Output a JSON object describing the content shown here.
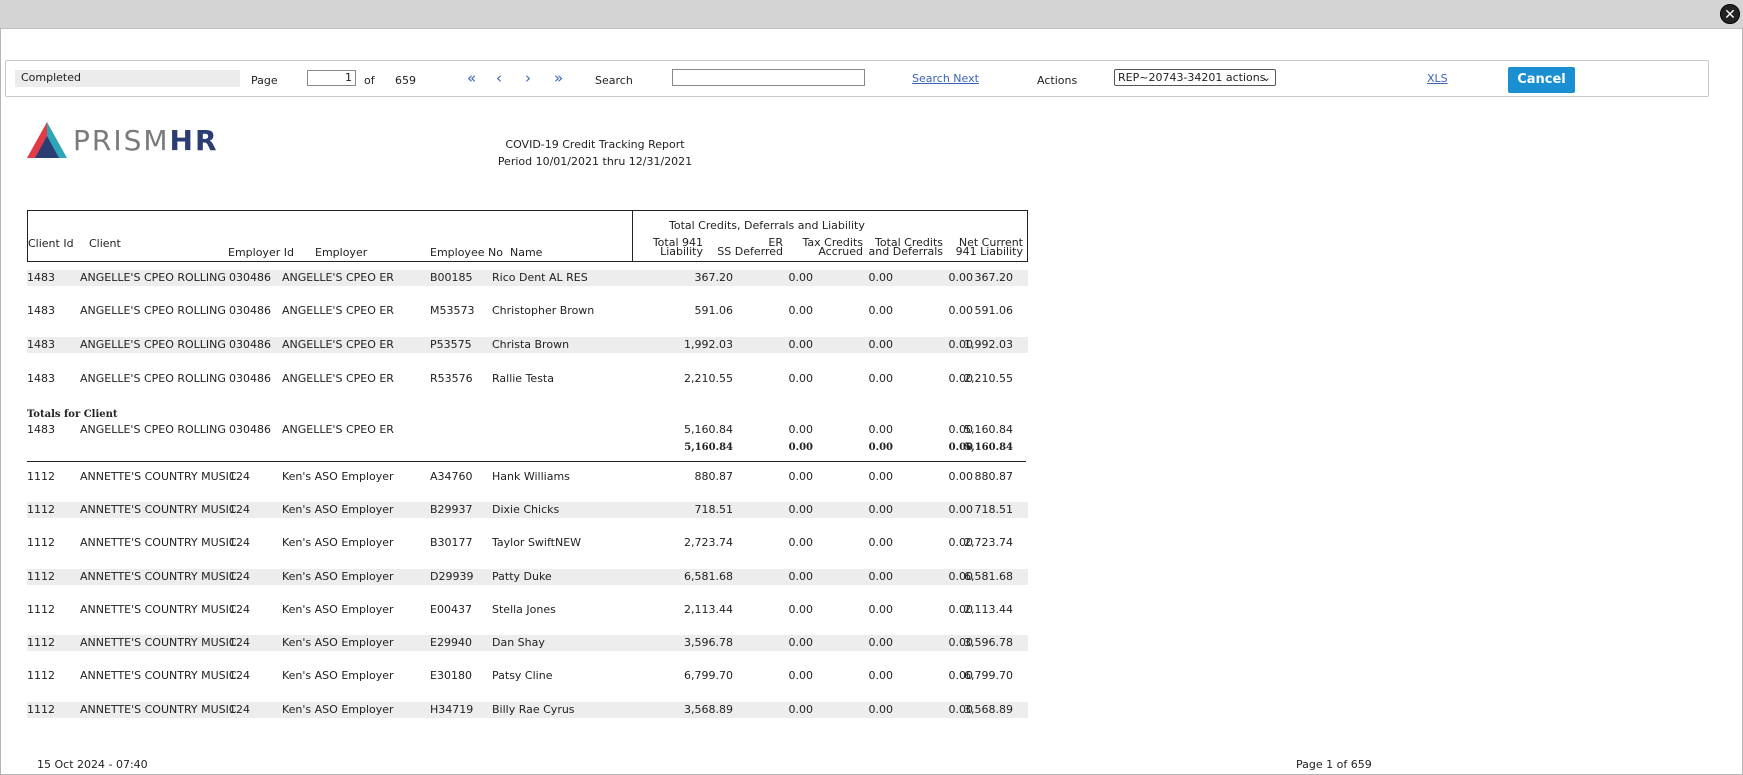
{
  "toolbar": {
    "status": "Completed",
    "page_label": "Page",
    "page_value": "1",
    "of_label": "of",
    "total_pages": "659",
    "search_label": "Search",
    "search_value": "",
    "search_next": "Search Next",
    "actions_label": "Actions",
    "actions_selected": "REP~20743-34201 actions",
    "xls": "XLS",
    "cancel": "Cancel"
  },
  "logo": {
    "part1": "PRISM",
    "part2": "HR"
  },
  "report": {
    "title": "COVID-19 Credit Tracking Report",
    "period": "Period 10/01/2021 thru 12/31/2021"
  },
  "headers": {
    "group": "Total Credits, Deferrals and Liability",
    "client_id": "Client Id",
    "client": "Client",
    "employer_id": "Employer Id",
    "employer": "Employer",
    "employee_no": "Employee No",
    "name": "Name",
    "total941_1": "Total 941",
    "total941_2": "Liability",
    "er_1": "ER",
    "er_2": "SS Deferred",
    "tax_1": "Tax Credits",
    "tax_2": "Accrued",
    "tcd_1": "Total Credits",
    "tcd_2": "and Deferrals",
    "net_1": "Net Current",
    "net_2": "941 Liability"
  },
  "rows_group1": [
    {
      "client_id": "1483",
      "client": "ANGELLE'S CPEO ROLLING",
      "employer_id": "030486",
      "employer": "ANGELLE'S CPEO ER",
      "employee_no": "B00185",
      "name": "Rico Dent AL RES",
      "total": "367.20",
      "er": "0.00",
      "tax": "0.00",
      "tcd": "0.00",
      "net": "367.20"
    },
    {
      "client_id": "1483",
      "client": "ANGELLE'S CPEO ROLLING",
      "employer_id": "030486",
      "employer": "ANGELLE'S CPEO ER",
      "employee_no": "M53573",
      "name": "Christopher Brown",
      "total": "591.06",
      "er": "0.00",
      "tax": "0.00",
      "tcd": "0.00",
      "net": "591.06"
    },
    {
      "client_id": "1483",
      "client": "ANGELLE'S CPEO ROLLING",
      "employer_id": "030486",
      "employer": "ANGELLE'S CPEO ER",
      "employee_no": "P53575",
      "name": "Christa Brown",
      "total": "1,992.03",
      "er": "0.00",
      "tax": "0.00",
      "tcd": "0.00",
      "net": "1,992.03"
    },
    {
      "client_id": "1483",
      "client": "ANGELLE'S CPEO ROLLING",
      "employer_id": "030486",
      "employer": "ANGELLE'S CPEO ER",
      "employee_no": "R53576",
      "name": "Rallie Testa",
      "total": "2,210.55",
      "er": "0.00",
      "tax": "0.00",
      "tcd": "0.00",
      "net": "2,210.55"
    }
  ],
  "totals": {
    "label": "Totals for Client",
    "row": {
      "client_id": "1483",
      "client": "ANGELLE'S CPEO ROLLING",
      "employer_id": "030486",
      "employer": "ANGELLE'S CPEO ER",
      "total": "5,160.84",
      "er": "0.00",
      "tax": "0.00",
      "tcd": "0.00",
      "net": "5,160.84"
    },
    "sub": {
      "total": "5,160.84",
      "er": "0.00",
      "tax": "0.00",
      "tcd": "0.00",
      "net": "5,160.84"
    }
  },
  "rows_group2": [
    {
      "client_id": "1112",
      "client": "ANNETTE'S COUNTRY MUSIC",
      "employer_id": "124",
      "employer": "Ken's ASO Employer",
      "employee_no": "A34760",
      "name": "Hank Williams",
      "total": "880.87",
      "er": "0.00",
      "tax": "0.00",
      "tcd": "0.00",
      "net": "880.87"
    },
    {
      "client_id": "1112",
      "client": "ANNETTE'S COUNTRY MUSIC",
      "employer_id": "124",
      "employer": "Ken's ASO Employer",
      "employee_no": "B29937",
      "name": "Dixie Chicks",
      "total": "718.51",
      "er": "0.00",
      "tax": "0.00",
      "tcd": "0.00",
      "net": "718.51"
    },
    {
      "client_id": "1112",
      "client": "ANNETTE'S COUNTRY MUSIC",
      "employer_id": "124",
      "employer": "Ken's ASO Employer",
      "employee_no": "B30177",
      "name": "Taylor SwiftNEW",
      "total": "2,723.74",
      "er": "0.00",
      "tax": "0.00",
      "tcd": "0.00",
      "net": "2,723.74"
    },
    {
      "client_id": "1112",
      "client": "ANNETTE'S COUNTRY MUSIC",
      "employer_id": "124",
      "employer": "Ken's ASO Employer",
      "employee_no": "D29939",
      "name": "Patty Duke",
      "total": "6,581.68",
      "er": "0.00",
      "tax": "0.00",
      "tcd": "0.00",
      "net": "6,581.68"
    },
    {
      "client_id": "1112",
      "client": "ANNETTE'S COUNTRY MUSIC",
      "employer_id": "124",
      "employer": "Ken's ASO Employer",
      "employee_no": "E00437",
      "name": "Stella Jones",
      "total": "2,113.44",
      "er": "0.00",
      "tax": "0.00",
      "tcd": "0.00",
      "net": "2,113.44"
    },
    {
      "client_id": "1112",
      "client": "ANNETTE'S COUNTRY MUSIC",
      "employer_id": "124",
      "employer": "Ken's ASO Employer",
      "employee_no": "E29940",
      "name": "Dan Shay",
      "total": "3,596.78",
      "er": "0.00",
      "tax": "0.00",
      "tcd": "0.00",
      "net": "3,596.78"
    },
    {
      "client_id": "1112",
      "client": "ANNETTE'S COUNTRY MUSIC",
      "employer_id": "124",
      "employer": "Ken's ASO Employer",
      "employee_no": "E30180",
      "name": "Patsy Cline",
      "total": "6,799.70",
      "er": "0.00",
      "tax": "0.00",
      "tcd": "0.00",
      "net": "6,799.70"
    },
    {
      "client_id": "1112",
      "client": "ANNETTE'S COUNTRY MUSIC",
      "employer_id": "124",
      "employer": "Ken's ASO Employer",
      "employee_no": "H34719",
      "name": "Billy Rae Cyrus",
      "total": "3,568.89",
      "er": "0.00",
      "tax": "0.00",
      "tcd": "0.00",
      "net": "3,568.89"
    }
  ],
  "footer": {
    "timestamp": "15 Oct 2024 - 07:40",
    "page": "Page 1 of 659"
  }
}
